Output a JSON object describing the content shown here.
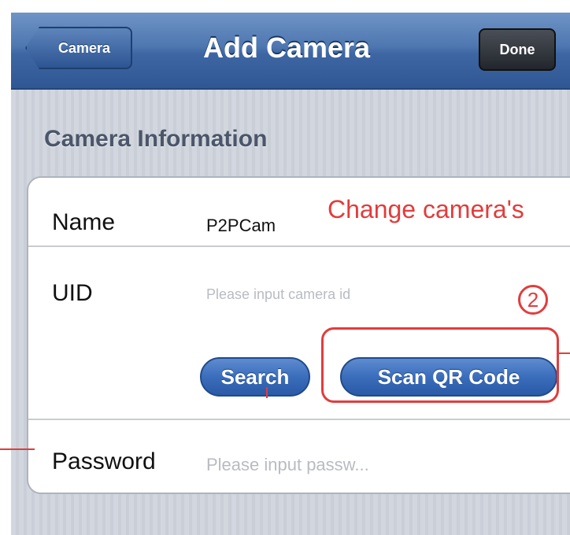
{
  "navbar": {
    "back_label": "Camera",
    "title": "Add Camera",
    "done_label": "Done"
  },
  "section": {
    "header": "Camera Information"
  },
  "form": {
    "name_label": "Name",
    "name_value": "P2PCam",
    "uid_label": "UID",
    "uid_placeholder": "Please input camera id",
    "search_label": "Search",
    "scan_label": "Scan QR Code",
    "password_label": "Password",
    "password_placeholder": "Please input passw..."
  },
  "annotations": {
    "name_note": "Change camera's",
    "step_number": "2",
    "accent_color": "#e23c3c"
  }
}
